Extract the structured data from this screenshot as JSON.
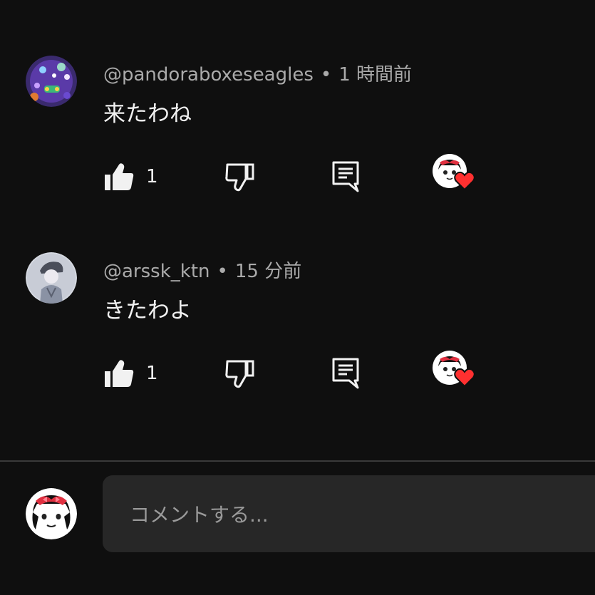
{
  "comments": [
    {
      "author": "@pandoraboxeseagles",
      "time": "1 時間前",
      "text": "来たわね",
      "likes": "1",
      "avatar_icon": "purple-creature-avatar"
    },
    {
      "author": "@arssk_ktn",
      "time": "15 分前",
      "text": "きたわよ",
      "likes": "1",
      "avatar_icon": "anime-character-avatar"
    }
  ],
  "separator": "•",
  "composer": {
    "placeholder": "コメントする..."
  },
  "icons": {
    "like": "thumbs-up-icon",
    "dislike": "thumbs-down-icon",
    "reply": "reply-icon",
    "creator_heart": "creator-heart-icon"
  },
  "colors": {
    "background": "#0f0f0f",
    "input_bg": "#272727",
    "heart": "#ff3030",
    "meta_text": "#aaaaaa"
  }
}
